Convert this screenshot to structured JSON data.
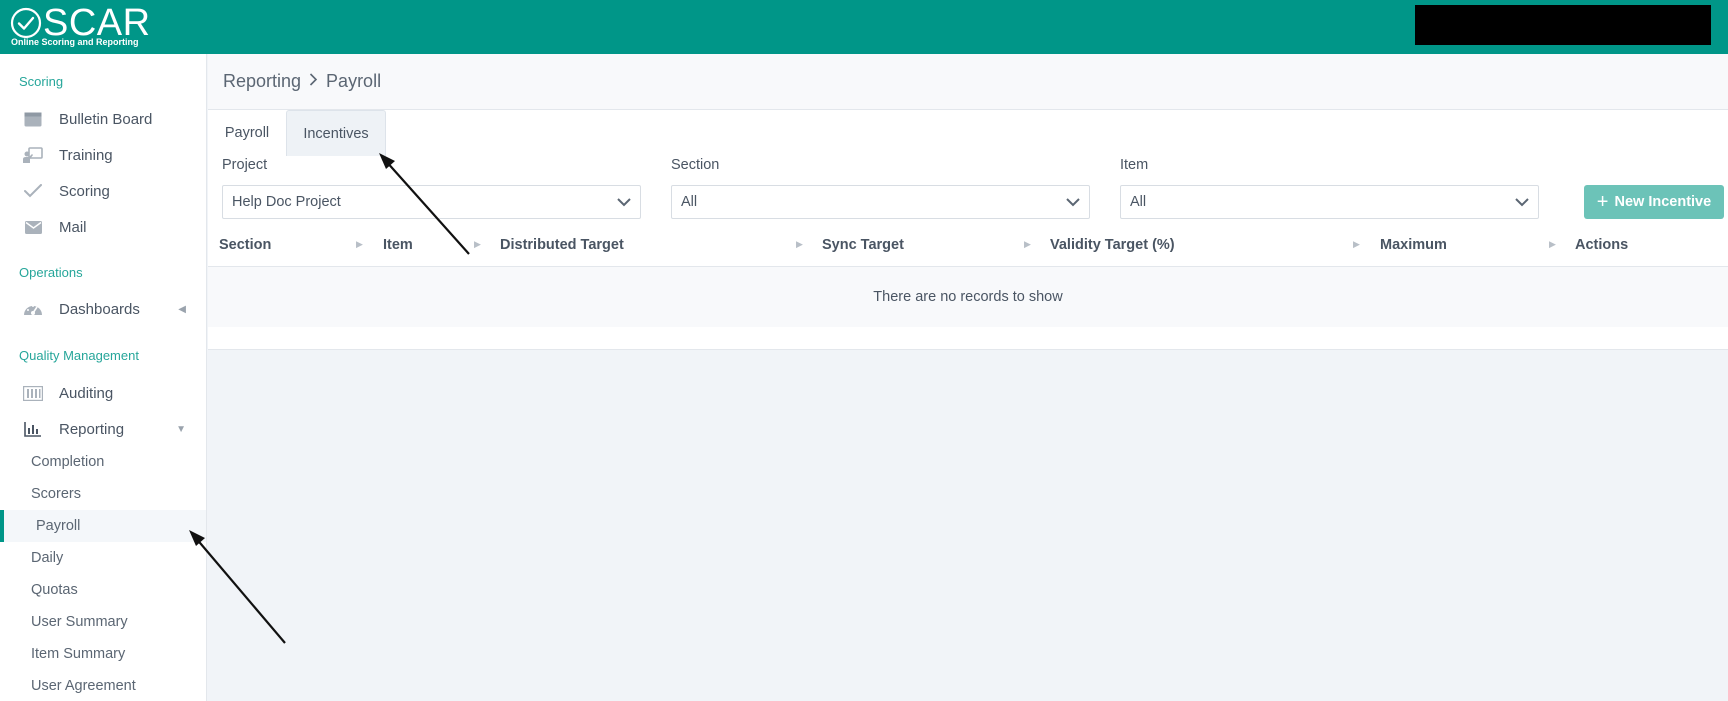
{
  "brand": {
    "name": "SCAR",
    "tagline": "Online Scoring and Reporting",
    "color": "#009688"
  },
  "sidebar": {
    "sections": [
      {
        "title": "Scoring",
        "items": [
          {
            "label": "Bulletin Board",
            "icon": "bulletin-board-icon"
          },
          {
            "label": "Training",
            "icon": "training-icon"
          },
          {
            "label": "Scoring",
            "icon": "check-icon"
          },
          {
            "label": "Mail",
            "icon": "mail-icon"
          }
        ]
      },
      {
        "title": "Operations",
        "items": [
          {
            "label": "Dashboards",
            "icon": "dashboard-icon"
          }
        ]
      },
      {
        "title": "Quality Management",
        "items": [
          {
            "label": "Auditing",
            "icon": "auditing-icon"
          },
          {
            "label": "Reporting",
            "icon": "reporting-icon"
          }
        ]
      }
    ],
    "reporting_sub": [
      "Completion",
      "Scorers",
      "Payroll",
      "Daily",
      "Quotas",
      "User Summary",
      "Item Summary",
      "User Agreement"
    ],
    "active_sub": "Payroll"
  },
  "breadcrumb": {
    "parent": "Reporting",
    "current": "Payroll"
  },
  "tabs": [
    "Payroll",
    "Incentives"
  ],
  "active_tab": "Incentives",
  "filters": {
    "project": {
      "label": "Project",
      "value": "Help Doc Project"
    },
    "section": {
      "label": "Section",
      "value": "All"
    },
    "item": {
      "label": "Item",
      "value": "All"
    }
  },
  "new_button": "New Incentive",
  "table": {
    "columns": [
      "Section",
      "Item",
      "Distributed Target",
      "Sync Target",
      "Validity Target (%)",
      "Maximum",
      "Actions"
    ],
    "empty_text": "There are no records to show"
  }
}
